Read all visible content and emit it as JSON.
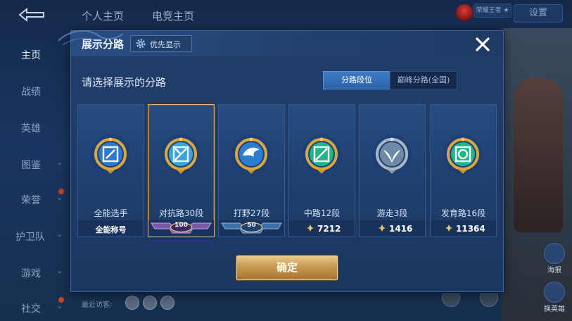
{
  "background": {
    "top_tabs": [
      "个人主页",
      "电竞主页"
    ],
    "settings_label": "设置",
    "chip_text": "荣耀王者 ★",
    "sidebar": [
      {
        "label": "主页",
        "active": true,
        "chevron": false
      },
      {
        "label": "战绩",
        "active": false,
        "chevron": false
      },
      {
        "label": "英雄",
        "active": false,
        "chevron": false
      },
      {
        "label": "图鉴",
        "active": false,
        "chevron": true
      },
      {
        "label": "荣誉",
        "active": false,
        "chevron": true
      },
      {
        "label": "护卫队",
        "active": false,
        "chevron": true
      },
      {
        "label": "游戏",
        "active": false,
        "chevron": true
      },
      {
        "label": "社交",
        "active": false,
        "chevron": true
      }
    ],
    "visitors_label": "最近访客:",
    "haibao_label": "海报",
    "huan_label": "换英雄"
  },
  "dialog": {
    "title": "展示分路",
    "priority_label": "优先显示",
    "subtitle": "请选择展示的分路",
    "segments": [
      {
        "label": "分路段位",
        "active": true
      },
      {
        "label": "巅峰分路(全国)",
        "active": false
      }
    ],
    "confirm_label": "确定"
  },
  "cards": [
    {
      "role": "全能选手",
      "footer_text": "全能称号",
      "selected": false,
      "icon": "allround-emblem-icon",
      "color": "#3a86d8"
    },
    {
      "role": "对抗路30段",
      "rank_badge": "100",
      "selected": true,
      "icon": "clash-lane-emblem-icon",
      "color": "#37a7e0"
    },
    {
      "role": "打野27段",
      "rank_badge": "50",
      "selected": false,
      "icon": "jungle-emblem-icon",
      "color": "#2f7fd0"
    },
    {
      "role": "中路12段",
      "points": "7212",
      "selected": false,
      "icon": "mid-lane-emblem-icon",
      "color": "#1fb58a"
    },
    {
      "role": "游走3段",
      "points": "1416",
      "selected": false,
      "icon": "roam-emblem-icon",
      "color": "#8fa4b8"
    },
    {
      "role": "发育路16段",
      "points": "11364",
      "selected": false,
      "icon": "farm-lane-emblem-icon",
      "color": "#1fb58a"
    }
  ]
}
